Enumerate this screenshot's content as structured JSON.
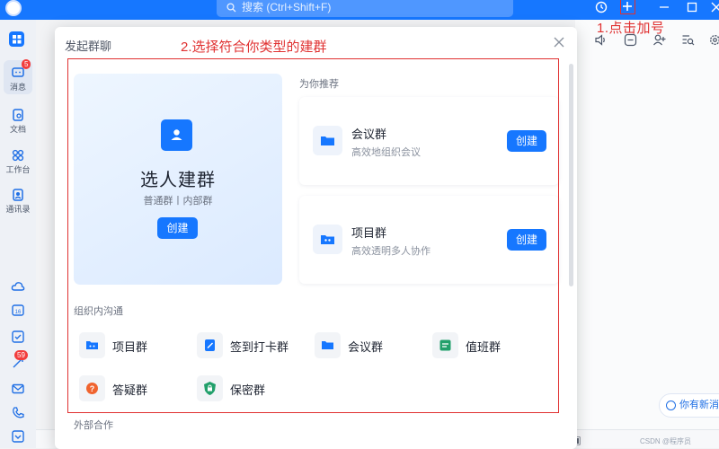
{
  "topbar": {
    "search_placeholder": "搜索 (Ctrl+Shift+F)",
    "annotation_add": "1.点击加号"
  },
  "sidebar": {
    "items": [
      {
        "label": "消息",
        "badge": "5"
      },
      {
        "label": "文档"
      },
      {
        "label": "工作台"
      },
      {
        "label": "通讯录"
      }
    ],
    "lower_badge": "59"
  },
  "modal": {
    "title": "发起群聊",
    "annotation_choose": "2.选择符合你类型的建群",
    "manual": {
      "title": "选人建群",
      "subtitle": "普通群丨内部群",
      "button": "创建"
    },
    "recommended": {
      "heading": "为你推荐",
      "cards": [
        {
          "title": "会议群",
          "desc": "高效地组织会议",
          "button": "创建"
        },
        {
          "title": "项目群",
          "desc": "高效透明多人协作",
          "button": "创建"
        }
      ]
    },
    "internal": {
      "heading": "组织内沟通",
      "items": [
        {
          "label": "项目群",
          "icon": "project-group-icon"
        },
        {
          "label": "签到打卡群",
          "icon": "checkin-group-icon"
        },
        {
          "label": "会议群",
          "icon": "meeting-group-icon"
        },
        {
          "label": "值班群",
          "icon": "duty-group-icon"
        },
        {
          "label": "答疑群",
          "icon": "qa-group-icon"
        },
        {
          "label": "保密群",
          "icon": "secret-group-icon"
        }
      ]
    },
    "external": {
      "heading": "外部合作"
    }
  },
  "right_panel": {
    "suggestion": "你有新消"
  },
  "watermark": "CSDN @程序员",
  "colors": {
    "brand": "#1677ff",
    "annotation": "#e03131",
    "card_bg": "#eef6ff"
  }
}
